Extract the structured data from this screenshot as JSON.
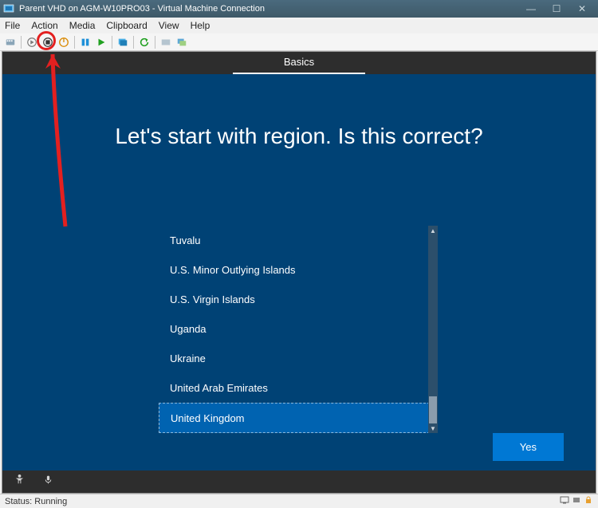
{
  "window": {
    "title": "Parent VHD on AGM-W10PRO03 - Virtual Machine Connection",
    "controls": {
      "minimize": "—",
      "maximize": "☐",
      "close": "✕"
    }
  },
  "menu": [
    "File",
    "Action",
    "Media",
    "Clipboard",
    "View",
    "Help"
  ],
  "oobe": {
    "tab": "Basics",
    "heading": "Let's start with region. Is this correct?",
    "regions": [
      {
        "label": "Tuvalu",
        "selected": false
      },
      {
        "label": "U.S. Minor Outlying Islands",
        "selected": false
      },
      {
        "label": "U.S. Virgin Islands",
        "selected": false
      },
      {
        "label": "Uganda",
        "selected": false
      },
      {
        "label": "Ukraine",
        "selected": false
      },
      {
        "label": "United Arab Emirates",
        "selected": false
      },
      {
        "label": "United Kingdom",
        "selected": true
      }
    ],
    "yes": "Yes"
  },
  "status": {
    "text": "Status: Running"
  }
}
